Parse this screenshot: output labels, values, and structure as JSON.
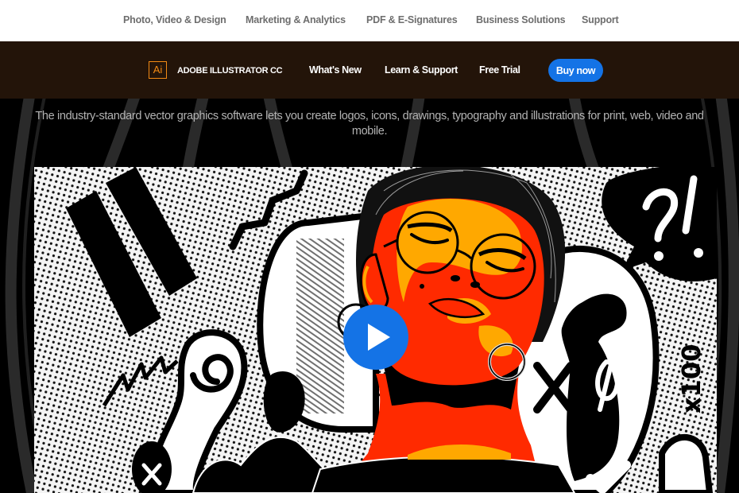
{
  "global_nav": {
    "items": [
      {
        "label": "Photo, Video & Design"
      },
      {
        "label": "Marketing & Analytics"
      },
      {
        "label": "PDF & E-Signatures"
      },
      {
        "label": "Business Solutions"
      },
      {
        "label": "Support"
      }
    ]
  },
  "product_nav": {
    "logo_text": "Ai",
    "product_name": "ADOBE ILLUSTRATOR CC",
    "links": [
      {
        "label": "What's New"
      },
      {
        "label": "Learn & Support"
      },
      {
        "label": "Free Trial"
      }
    ],
    "buy_label": "Buy now"
  },
  "hero": {
    "tagline": "The industry-standard vector graphics software lets you create logos, icons, drawings, typography and illustrations for print, web, video and mobile.",
    "artwork": {
      "description": "Pop-art illustration of a woman with round glasses, red and orange face, comic doodles",
      "doodle_text": "x100"
    },
    "play_icon": "play-icon"
  },
  "colors": {
    "brand_orange": "#f28a14",
    "nav_bg": "#231409",
    "cta_blue": "#1473e6",
    "face_red": "#ff2a00",
    "face_orange": "#ffa800"
  }
}
